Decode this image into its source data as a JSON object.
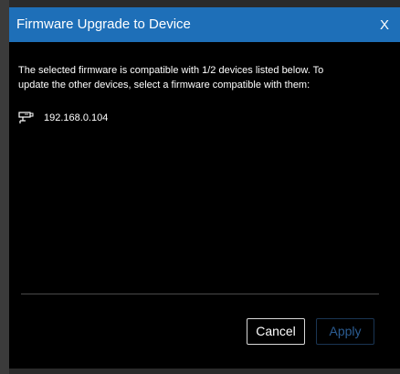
{
  "dialog": {
    "title": "Firmware Upgrade to Device",
    "close_label": "X",
    "message_line1": "The selected firmware is compatible with 1/2 devices listed below. To",
    "message_line2": "update the other devices, select a firmware compatible with them:",
    "devices": [
      {
        "icon": "camera-icon",
        "ip": "192.168.0.104"
      }
    ],
    "buttons": {
      "cancel_label": "Cancel",
      "apply_label": "Apply"
    }
  },
  "colors": {
    "titlebar": "#1e6fb8",
    "background": "#000000",
    "apply_disabled_text": "#2b5c92"
  }
}
